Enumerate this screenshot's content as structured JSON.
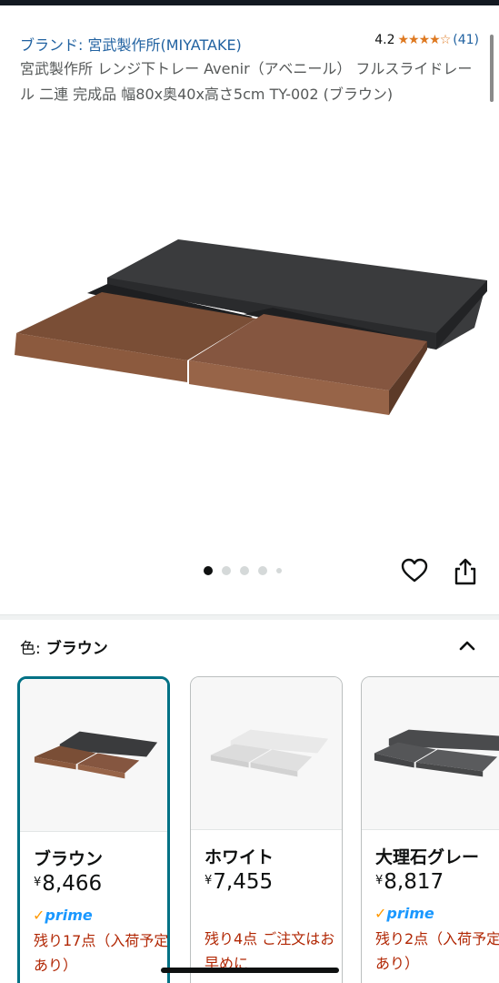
{
  "header": {
    "brand_link": "ブランド: 宮武製作所(MIYATAKE)",
    "rating_value": "4.2",
    "rating_stars": "★★★★☆",
    "rating_count": "(41)"
  },
  "product": {
    "title": "宮武製作所 レンジ下トレー Avenir（アベニール） フルスライドレール 二連 完成品 幅80x奥40x高さ5cm TY-002 (ブラウン)"
  },
  "gallery": {
    "image_count": 5,
    "active_index": 0
  },
  "variation": {
    "label": "色:",
    "selected_value": "ブラウン",
    "options": [
      {
        "name": "ブラウン",
        "currency": "¥",
        "price": "8,466",
        "prime": "prime",
        "stock": "残り17点（入荷予定あり）",
        "selected": true,
        "variant_color": "brown"
      },
      {
        "name": "ホワイト",
        "currency": "¥",
        "price": "7,455",
        "prime": "",
        "stock": "残り4点 ご注文はお早めに",
        "selected": false,
        "variant_color": "white"
      },
      {
        "name": "大理石グレー",
        "currency": "¥",
        "price": "8,817",
        "prime": "prime",
        "stock": "残り2点（入荷予定あり）",
        "selected": false,
        "variant_color": "marble-grey"
      }
    ]
  },
  "colors": {
    "link": "#2162a1",
    "star": "#de7921",
    "selected_border": "#007185",
    "stock_red": "#b12704",
    "prime_blue": "#1a98ff"
  },
  "icons": {
    "wishlist": "heart-icon",
    "share": "share-icon",
    "collapse": "chevron-up-icon"
  }
}
